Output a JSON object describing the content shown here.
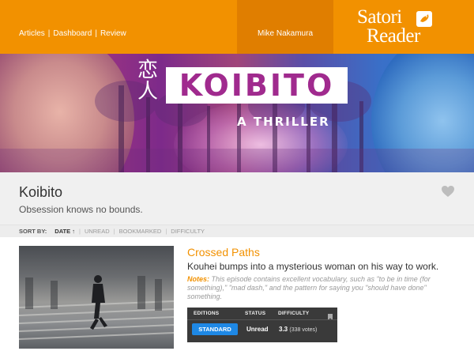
{
  "nav": {
    "links": [
      {
        "label": "Articles"
      },
      {
        "label": "Dashboard"
      },
      {
        "label": "Review"
      }
    ],
    "separator": "|",
    "user_name": "Mike Nakamura",
    "logo_line1": "Satori",
    "logo_line2": "Reader"
  },
  "banner": {
    "kanji": "恋人",
    "title": "KOIBITO",
    "subtitle": "A THRILLER"
  },
  "series": {
    "title": "Koibito",
    "tagline": "Obsession knows no bounds."
  },
  "sort": {
    "label": "SORT BY:",
    "options": [
      {
        "label": "DATE ↑",
        "active": true
      },
      {
        "label": "UNREAD",
        "active": false
      },
      {
        "label": "BOOKMARKED",
        "active": false
      },
      {
        "label": "DIFFICULTY",
        "active": false
      }
    ],
    "separator": "|"
  },
  "episode": {
    "title": "Crossed Paths",
    "description": "Kouhei bumps into a mysterious woman on his way to work.",
    "notes_label": "Notes:",
    "notes_text": "This episode contains excellent vocabulary, such as \"to be in time (for something),\" \"mad dash,\" and the pattern for saying you \"should have done\" something.",
    "table": {
      "headers": {
        "editions": "EDITIONS",
        "status": "STATUS",
        "difficulty": "DIFFICULTY"
      },
      "edition_button": "STANDARD",
      "status": "Unread",
      "difficulty": "3.3",
      "votes": "(338 votes)"
    }
  },
  "colors": {
    "brand_orange": "#f29100",
    "user_box": "#e07e00",
    "edition_button": "#1e88e5",
    "table_bg": "#3a3a3a"
  },
  "icons": {
    "logo_bird": "bird-icon",
    "favorite": "heart-icon",
    "bookmark": "bookmark-icon"
  }
}
